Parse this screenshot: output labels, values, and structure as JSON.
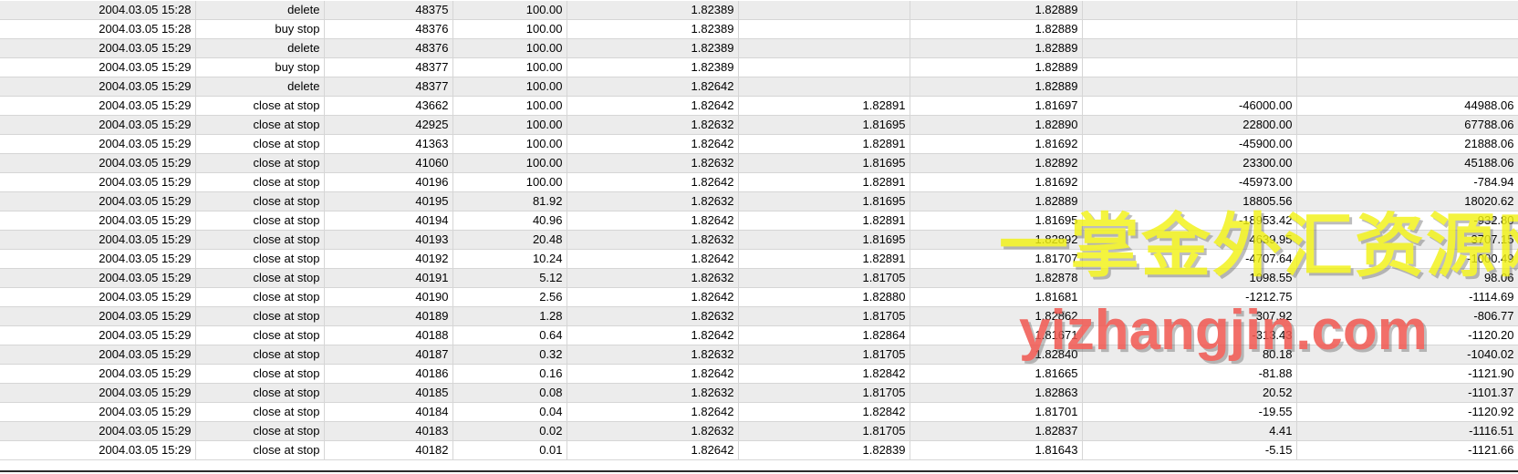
{
  "rows": [
    [
      "2004.03.05 15:28",
      "delete",
      "48375",
      "100.00",
      "1.82389",
      "",
      "1.82889",
      "",
      ""
    ],
    [
      "2004.03.05 15:28",
      "buy stop",
      "48376",
      "100.00",
      "1.82389",
      "",
      "1.82889",
      "",
      ""
    ],
    [
      "2004.03.05 15:29",
      "delete",
      "48376",
      "100.00",
      "1.82389",
      "",
      "1.82889",
      "",
      ""
    ],
    [
      "2004.03.05 15:29",
      "buy stop",
      "48377",
      "100.00",
      "1.82389",
      "",
      "1.82889",
      "",
      ""
    ],
    [
      "2004.03.05 15:29",
      "delete",
      "48377",
      "100.00",
      "1.82642",
      "",
      "1.82889",
      "",
      ""
    ],
    [
      "2004.03.05 15:29",
      "close at stop",
      "43662",
      "100.00",
      "1.82642",
      "1.82891",
      "1.81697",
      "-46000.00",
      "44988.06"
    ],
    [
      "2004.03.05 15:29",
      "close at stop",
      "42925",
      "100.00",
      "1.82632",
      "1.81695",
      "1.82890",
      "22800.00",
      "67788.06"
    ],
    [
      "2004.03.05 15:29",
      "close at stop",
      "41363",
      "100.00",
      "1.82642",
      "1.82891",
      "1.81692",
      "-45900.00",
      "21888.06"
    ],
    [
      "2004.03.05 15:29",
      "close at stop",
      "41060",
      "100.00",
      "1.82632",
      "1.81695",
      "1.82892",
      "23300.00",
      "45188.06"
    ],
    [
      "2004.03.05 15:29",
      "close at stop",
      "40196",
      "100.00",
      "1.82642",
      "1.82891",
      "1.81692",
      "-45973.00",
      "-784.94"
    ],
    [
      "2004.03.05 15:29",
      "close at stop",
      "40195",
      "81.92",
      "1.82632",
      "1.81695",
      "1.82889",
      "18805.56",
      "18020.62"
    ],
    [
      "2004.03.05 15:29",
      "close at stop",
      "40194",
      "40.96",
      "1.82642",
      "1.82891",
      "1.81695",
      "-18953.42",
      "-932.80"
    ],
    [
      "2004.03.05 15:29",
      "close at stop",
      "40193",
      "20.48",
      "1.82632",
      "1.81695",
      "1.82892",
      "4639.95",
      "3707.15"
    ],
    [
      "2004.03.05 15:29",
      "close at stop",
      "40192",
      "10.24",
      "1.82642",
      "1.82891",
      "1.81707",
      "-4707.64",
      "-1000.49"
    ],
    [
      "2004.03.05 15:29",
      "close at stop",
      "40191",
      "5.12",
      "1.82632",
      "1.81705",
      "1.82878",
      "1098.55",
      "98.06"
    ],
    [
      "2004.03.05 15:29",
      "close at stop",
      "40190",
      "2.56",
      "1.82642",
      "1.82880",
      "1.81681",
      "-1212.75",
      "-1114.69"
    ],
    [
      "2004.03.05 15:29",
      "close at stop",
      "40189",
      "1.28",
      "1.82632",
      "1.81705",
      "1.82862",
      "307.92",
      "-806.77"
    ],
    [
      "2004.03.05 15:29",
      "close at stop",
      "40188",
      "0.64",
      "1.82642",
      "1.82864",
      "1.81671",
      "-313.43",
      "-1120.20"
    ],
    [
      "2004.03.05 15:29",
      "close at stop",
      "40187",
      "0.32",
      "1.82632",
      "1.81705",
      "1.82840",
      "80.18",
      "-1040.02"
    ],
    [
      "2004.03.05 15:29",
      "close at stop",
      "40186",
      "0.16",
      "1.82642",
      "1.82842",
      "1.81665",
      "-81.88",
      "-1121.90"
    ],
    [
      "2004.03.05 15:29",
      "close at stop",
      "40185",
      "0.08",
      "1.82632",
      "1.81705",
      "1.82863",
      "20.52",
      "-1101.37"
    ],
    [
      "2004.03.05 15:29",
      "close at stop",
      "40184",
      "0.04",
      "1.82642",
      "1.82842",
      "1.81701",
      "-19.55",
      "-1120.92"
    ],
    [
      "2004.03.05 15:29",
      "close at stop",
      "40183",
      "0.02",
      "1.82632",
      "1.81705",
      "1.82837",
      "4.41",
      "-1116.51"
    ],
    [
      "2004.03.05 15:29",
      "close at stop",
      "40182",
      "0.01",
      "1.82642",
      "1.82839",
      "1.81643",
      "-5.15",
      "-1121.66"
    ]
  ],
  "watermark": {
    "chinese": "一掌金外汇资源网",
    "url": "yizhangjin.com"
  },
  "colors": {
    "row_odd": "#ececec",
    "row_even": "#ffffff",
    "grid_line": "#d6d6d6",
    "watermark_cn": "#f2f215",
    "watermark_en": "#f0564f"
  }
}
